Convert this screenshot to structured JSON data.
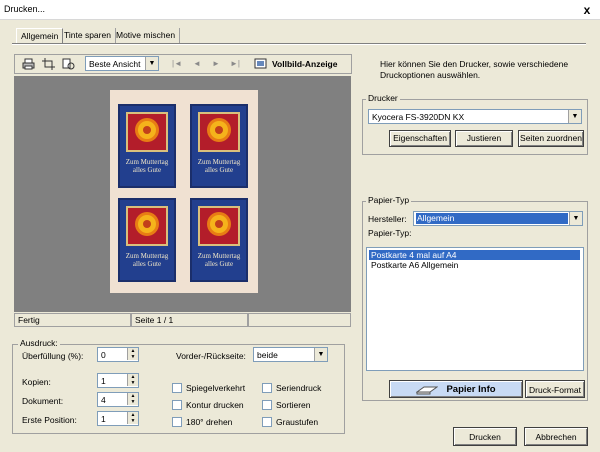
{
  "window": {
    "title": "Drucken...",
    "close": "x"
  },
  "tabs": [
    "Allgemein",
    "Tinte sparen",
    "Motive mischen"
  ],
  "toolbar": {
    "icons": [
      "printer-icon",
      "crop-icon",
      "page-setup-icon"
    ],
    "view_select": "Beste Ansicht",
    "nav": [
      "|◄",
      "◄",
      "►",
      "►|"
    ],
    "fullscreen_label": "Vollbild-Anzeige"
  },
  "preview": {
    "card_text": "Zum Muttertag\nalles Gute"
  },
  "status": {
    "left": "Fertig",
    "page": "Seite 1 / 1",
    "right": ""
  },
  "description": "Hier können Sie den Drucker, sowie verschiedene Druckoptionen auswählen.",
  "drucker": {
    "label": "Drucker",
    "selected": "Kyocera FS-3920DN KX",
    "buttons": [
      "Eigenschaften",
      "Justieren",
      "Seiten zuordnen"
    ]
  },
  "papier_typ": {
    "label": "Papier-Typ",
    "hersteller_label": "Hersteller:",
    "hersteller_value": "Allgemein",
    "typ_label": "Papier-Typ:",
    "items": [
      "Postkarte 4 mal auf A4",
      "Postkarte A6 Allgemein"
    ],
    "selected_index": 0,
    "info_button": "Papier Info",
    "format_button": "Druck-Format"
  },
  "ausdruck": {
    "label": "Ausdruck:",
    "fields": [
      {
        "label": "Überfüllung (%):",
        "value": "0"
      },
      {
        "label": "Kopien:",
        "value": "1"
      },
      {
        "label": "Dokument:",
        "value": "4"
      },
      {
        "label": "Erste Position:",
        "value": "1"
      }
    ],
    "vorder_label": "Vorder-/Rückseite:",
    "vorder_value": "beide",
    "checkboxes": [
      "Spiegelverkehrt",
      "Seriendruck",
      "Kontur drucken",
      "Sortieren",
      "180° drehen",
      "Graustufen"
    ]
  },
  "dialog_buttons": {
    "print": "Drucken",
    "cancel": "Abbrechen"
  }
}
